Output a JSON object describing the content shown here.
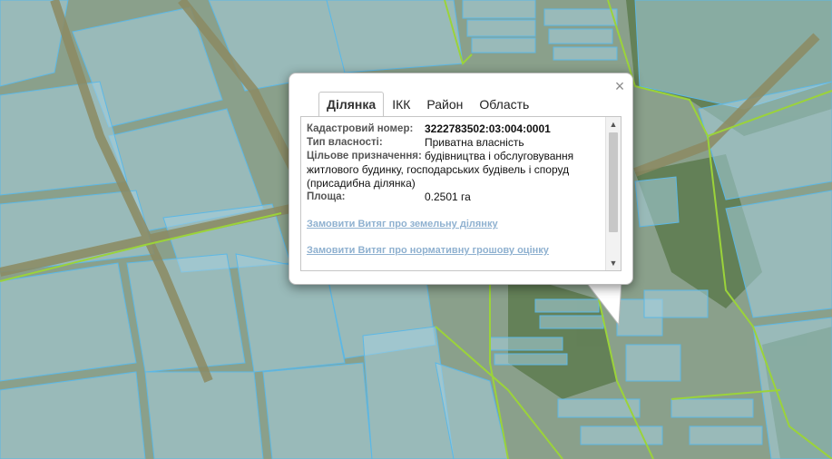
{
  "popup": {
    "tabs": [
      {
        "label": "Ділянка",
        "active": true
      },
      {
        "label": "ІКК",
        "active": false
      },
      {
        "label": "Район",
        "active": false
      },
      {
        "label": "Область",
        "active": false
      }
    ],
    "close_icon": "close-icon",
    "fields": {
      "cadastral_label": "Кадастровий номер:",
      "cadastral_value": "3222783502:03:004:0001",
      "ownership_label": "Тип власності:",
      "ownership_value": "Приватна власність",
      "purpose_label": "Цільове призначення:",
      "purpose_value_line1": "будівництва і обслуговування",
      "purpose_value_rest": "житлового будинку, господарських будівель і споруд (присадибна ділянка)",
      "area_label": "Площа:",
      "area_value": "0.2501 га"
    },
    "links": {
      "order_extract": "Замовити Витяг про земельну ділянку",
      "order_valuation": "Замовити Витяг про нормативну грошову оцінку"
    }
  },
  "colors": {
    "parcel_fill": "#a9d7ef",
    "parcel_border": "#5cb8e6",
    "boundary_line": "#9bd33a",
    "road": "#8c8a62",
    "forest": "#5b7b4f"
  }
}
